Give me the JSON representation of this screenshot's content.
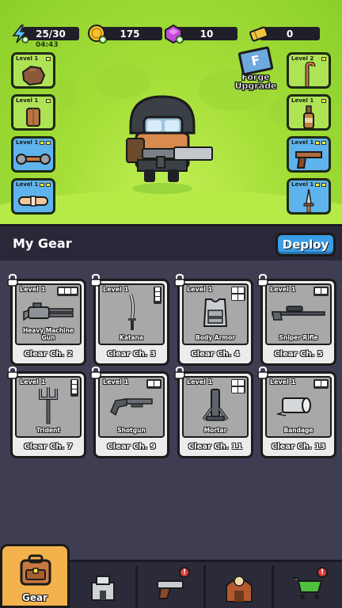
{
  "resources": {
    "energy": "25/30",
    "energy_timer": "04:43",
    "coins": "175",
    "gems": "10",
    "tickets": "0"
  },
  "forge": {
    "label_line1": "Forge",
    "label_line2": "Upgrade"
  },
  "equipped_left": [
    {
      "level": "Level 1",
      "item": "rock"
    },
    {
      "level": "Level 1",
      "item": "leather-armor"
    },
    {
      "level": "Level 1",
      "item": "wrench"
    },
    {
      "level": "Level 1",
      "item": "bandage-roll"
    }
  ],
  "equipped_right": [
    {
      "level": "Level 2",
      "item": "cane"
    },
    {
      "level": "Level 1",
      "item": "bottle"
    },
    {
      "level": "Level 1",
      "item": "pistol"
    },
    {
      "level": "Level 1",
      "item": "dagger"
    }
  ],
  "panel": {
    "title": "My Gear",
    "deploy_label": "Deploy"
  },
  "gear": [
    {
      "level": "Level 1",
      "name": "Heavy Machine Gun",
      "requirement": "Clear Ch. 2"
    },
    {
      "level": "Level 1",
      "name": "Katana",
      "requirement": "Clear Ch. 3"
    },
    {
      "level": "Level 1",
      "name": "Body Armor",
      "requirement": "Clear Ch. 4"
    },
    {
      "level": "Level 1",
      "name": "Sniper Rifle",
      "requirement": "Clear Ch. 5"
    },
    {
      "level": "Level 1",
      "name": "Trident",
      "requirement": "Clear Ch. 7"
    },
    {
      "level": "Level 1",
      "name": "Shotgun",
      "requirement": "Clear Ch. 9"
    },
    {
      "level": "Level 1",
      "name": "Mortar",
      "requirement": "Clear Ch. 11"
    },
    {
      "level": "Level 1",
      "name": "Bandage",
      "requirement": "Clear Ch. 13"
    }
  ],
  "nav": {
    "gear_label": "Gear"
  },
  "colors": {
    "accent": "#3a9de6",
    "nav_active": "#f3b24b",
    "panel": "#3f3d52",
    "badge": "#e23b3b"
  }
}
